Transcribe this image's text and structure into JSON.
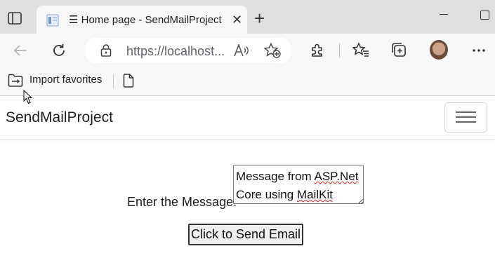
{
  "browser": {
    "tab": {
      "title": "☰ Home page - SendMailProject",
      "close_glyph": "✕",
      "favicon": "page-favicon-icon"
    },
    "new_tab_glyph": "+",
    "address": {
      "url": "https://localhost..."
    },
    "icons": {
      "tab_actions": "tab-actions-icon",
      "back": "back-arrow-icon",
      "reload": "reload-icon",
      "site_info": "lock-icon",
      "read_aloud": "read-aloud-icon",
      "add_favorite": "add-favorite-icon",
      "extensions": "extensions-icon",
      "favorites": "favorites-icon",
      "collections": "collections-icon",
      "profile": "profile-avatar",
      "more": "more-menu-icon",
      "minimize": "minimize-icon",
      "maximize": "maximize-icon"
    },
    "favorites_bar": {
      "import_label": "Import favorites",
      "folder_icon": "import-folder-icon",
      "page_icon": "other-favorites-icon"
    }
  },
  "page": {
    "brand": "SendMailProject",
    "nav_toggler": "hamburger-menu-icon",
    "form": {
      "message_label": "Enter the Message:",
      "message_prefix": "Message from ",
      "message_word1": "ASP.Net",
      "message_line2_prefix": "Core using ",
      "message_word2": "MailKit",
      "submit_label": "Click to Send Email"
    }
  },
  "colors": {
    "tabstrip": "#dfdfdf",
    "toolbar": "#f7f7f7",
    "spellcheck": "#d93025"
  }
}
